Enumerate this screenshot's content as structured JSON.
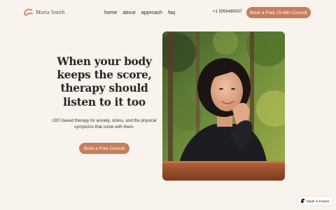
{
  "brand": {
    "name": "Maria Smith",
    "accent_color": "#c77e5c",
    "background_color": "#f8f3ed"
  },
  "nav": {
    "items": [
      {
        "label": "home"
      },
      {
        "label": "about"
      },
      {
        "label": "approach"
      },
      {
        "label": "faq"
      }
    ],
    "phone": "+1 5056480037",
    "cta_label": "Book a Free 15-Min Consult"
  },
  "hero": {
    "title": "When your body keeps the score, therapy should listen to it too",
    "subtitle": "CBT-based therapy for anxiety, stress, and the physical symptoms that come with them.",
    "cta_label": "Book a Free Consult"
  },
  "photo": {
    "icon": "therapist-portrait"
  },
  "framer_badge": {
    "label": "Made in Framer",
    "icon": "framer-icon"
  }
}
